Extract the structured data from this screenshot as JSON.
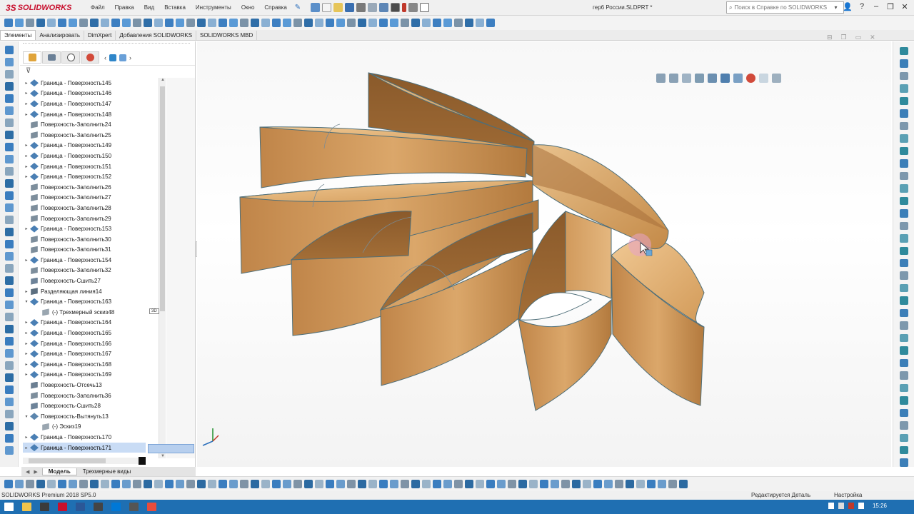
{
  "app": {
    "brand_ds": "3S",
    "brand_name": "SOLIDWORKS",
    "document_title": "гер6 России.SLDPRT *",
    "product_version": "SOLIDWORKS Premium 2018 SP5.0"
  },
  "menu": [
    "Файл",
    "Правка",
    "Вид",
    "Вставка",
    "Инструменты",
    "Окно",
    "Справка"
  ],
  "search": {
    "placeholder": "Поиск в Справке по SOLIDWORKS"
  },
  "tabs": [
    "Элементы",
    "Анализировать",
    "DimXpert",
    "Добавления SOLIDWORKS",
    "SOLIDWORKS MBD"
  ],
  "tree": {
    "filter_icon": "funnel-icon",
    "items": [
      {
        "label": "Граница - Поверхность145",
        "type": "boundary",
        "expand": "▸"
      },
      {
        "label": "Граница - Поверхность146",
        "type": "boundary",
        "expand": "▸"
      },
      {
        "label": "Граница - Поверхность147",
        "type": "boundary",
        "expand": "▸"
      },
      {
        "label": "Граница - Поверхность148",
        "type": "boundary",
        "expand": "▸"
      },
      {
        "label": "Поверхность-Заполнить24",
        "type": "fill",
        "expand": ""
      },
      {
        "label": "Поверхность-Заполнить25",
        "type": "fill",
        "expand": ""
      },
      {
        "label": "Граница - Поверхность149",
        "type": "boundary",
        "expand": "▸"
      },
      {
        "label": "Граница - Поверхность150",
        "type": "boundary",
        "expand": "▸"
      },
      {
        "label": "Граница - Поверхность151",
        "type": "boundary",
        "expand": "▸"
      },
      {
        "label": "Граница - Поверхность152",
        "type": "boundary",
        "expand": "▸"
      },
      {
        "label": "Поверхность-Заполнить26",
        "type": "fill",
        "expand": ""
      },
      {
        "label": "Поверхность-Заполнить27",
        "type": "fill",
        "expand": ""
      },
      {
        "label": "Поверхность-Заполнить28",
        "type": "fill",
        "expand": ""
      },
      {
        "label": "Поверхность-Заполнить29",
        "type": "fill",
        "expand": ""
      },
      {
        "label": "Граница - Поверхность153",
        "type": "boundary",
        "expand": "▸"
      },
      {
        "label": "Поверхность-Заполнить30",
        "type": "fill",
        "expand": ""
      },
      {
        "label": "Поверхность-Заполнить31",
        "type": "fill",
        "expand": ""
      },
      {
        "label": "Граница - Поверхность154",
        "type": "boundary",
        "expand": "▸"
      },
      {
        "label": "Поверхность-Заполнить32",
        "type": "fill",
        "expand": ""
      },
      {
        "label": "Поверхность-Сшить27",
        "type": "knit",
        "expand": ""
      },
      {
        "label": "Разделяющая линия14",
        "type": "split",
        "expand": "▸"
      },
      {
        "label": "Граница - Поверхность163",
        "type": "boundary",
        "expand": "▾"
      },
      {
        "label": "(-) Трехмерный эскиз48",
        "type": "sketch3d",
        "expand": "",
        "child": true
      },
      {
        "label": "Граница - Поверхность164",
        "type": "boundary",
        "expand": "▸"
      },
      {
        "label": "Граница - Поверхность165",
        "type": "boundary",
        "expand": "▸"
      },
      {
        "label": "Граница - Поверхность166",
        "type": "boundary",
        "expand": "▸"
      },
      {
        "label": "Граница - Поверхность167",
        "type": "boundary",
        "expand": "▸"
      },
      {
        "label": "Граница - Поверхность168",
        "type": "boundary",
        "expand": "▸"
      },
      {
        "label": "Граница - Поверхность169",
        "type": "boundary",
        "expand": "▸"
      },
      {
        "label": "Поверхность-Отсечь13",
        "type": "trim",
        "expand": ""
      },
      {
        "label": "Поверхность-Заполнить36",
        "type": "fill",
        "expand": ""
      },
      {
        "label": "Поверхность-Сшить28",
        "type": "knit",
        "expand": ""
      },
      {
        "label": "Поверхность-Вытянуть13",
        "type": "extrude",
        "expand": "▾"
      },
      {
        "label": "(-) Эскиз19",
        "type": "sketch",
        "expand": "",
        "child": true
      },
      {
        "label": "Граница - Поверхность170",
        "type": "boundary",
        "expand": "▸"
      },
      {
        "label": "Граница - Поверхность171",
        "type": "boundary",
        "expand": "▸",
        "selected": true
      }
    ],
    "tag_3d": "3D"
  },
  "bottom_tabs": [
    "Модель",
    "Трехмерные виды"
  ],
  "status": {
    "editing": "Редактируется Деталь",
    "settings": "Настройка"
  },
  "taskbar": {
    "clock": "15:26"
  },
  "colors": {
    "wood_light": "#e2b47a",
    "wood_mid": "#c8914f",
    "wood_dark": "#8a5a2b",
    "edge": "#4e6e78",
    "selection": "#c9dcf5",
    "taskbar": "#1f6fb2"
  }
}
